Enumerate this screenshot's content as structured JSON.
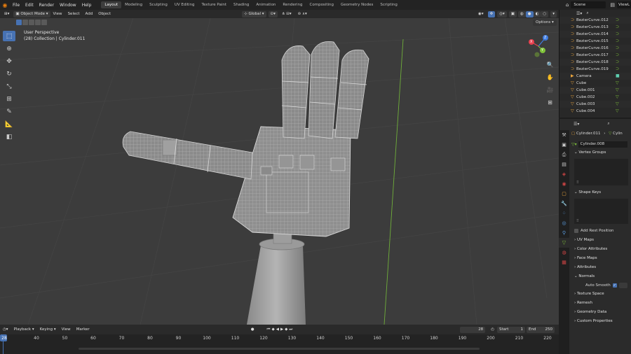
{
  "menu": [
    "File",
    "Edit",
    "Render",
    "Window",
    "Help"
  ],
  "workspaces": [
    "Layout",
    "Modeling",
    "Sculpting",
    "UV Editing",
    "Texture Paint",
    "Shading",
    "Animation",
    "Rendering",
    "Compositing",
    "Geometry Nodes",
    "Scripting"
  ],
  "active_workspace": "Layout",
  "scene_name": "Scene",
  "viewlayer": "ViewL",
  "header3d": {
    "mode": "Object Mode",
    "view": "View",
    "select": "Select",
    "add": "Add",
    "object": "Object",
    "orientation": "Global",
    "options": "Options"
  },
  "viewport": {
    "perspective": "User Perspective",
    "collection": "(28) Collection | Cylinder.011",
    "gizmo_axes": [
      "X",
      "Y",
      "Z"
    ]
  },
  "outliner": {
    "items": [
      "BezierCurve.012",
      "BezierCurve.013",
      "BezierCurve.014",
      "BezierCurve.015",
      "BezierCurve.016",
      "BezierCurve.017",
      "BezierCurve.018",
      "BezierCurve.019",
      "Camera",
      "Cube",
      "Cube.001",
      "Cube.002",
      "Cube.003",
      "Cube.004"
    ]
  },
  "properties": {
    "object_name": "Cylinder.011",
    "object_name_short": "Cylin",
    "mesh_name": "Cylinder.008",
    "panels": {
      "vertex_groups": "Vertex Groups",
      "shape_keys": "Shape Keys",
      "add_rest_position": "Add Rest Position",
      "uv_maps": "UV Maps",
      "color_attributes": "Color Attributes",
      "face_maps": "Face Maps",
      "attributes": "Attributes",
      "normals": "Normals",
      "auto_smooth": "Auto Smooth",
      "texture_space": "Texture Space",
      "remesh": "Remesh",
      "geometry_data": "Geometry Data",
      "custom_properties": "Custom Properties"
    }
  },
  "timeline": {
    "playback": "Playback",
    "keying": "Keying",
    "view": "View",
    "marker": "Marker",
    "current_frame": "28",
    "start_label": "Start",
    "start": "1",
    "end_label": "End",
    "end": "250",
    "ticks": [
      "28",
      "40",
      "50",
      "60",
      "70",
      "80",
      "90",
      "100",
      "110",
      "120",
      "130",
      "140",
      "150",
      "160",
      "170",
      "180",
      "190",
      "200",
      "210",
      "220"
    ]
  },
  "colors": {
    "accent_blue": "#4772b3",
    "x_axis": "#e8414f",
    "y_axis": "#7fc23a",
    "z_axis": "#3f7ce0",
    "mesh_icon": "#5ecfb0",
    "curve_icon": "#e8a33d"
  }
}
